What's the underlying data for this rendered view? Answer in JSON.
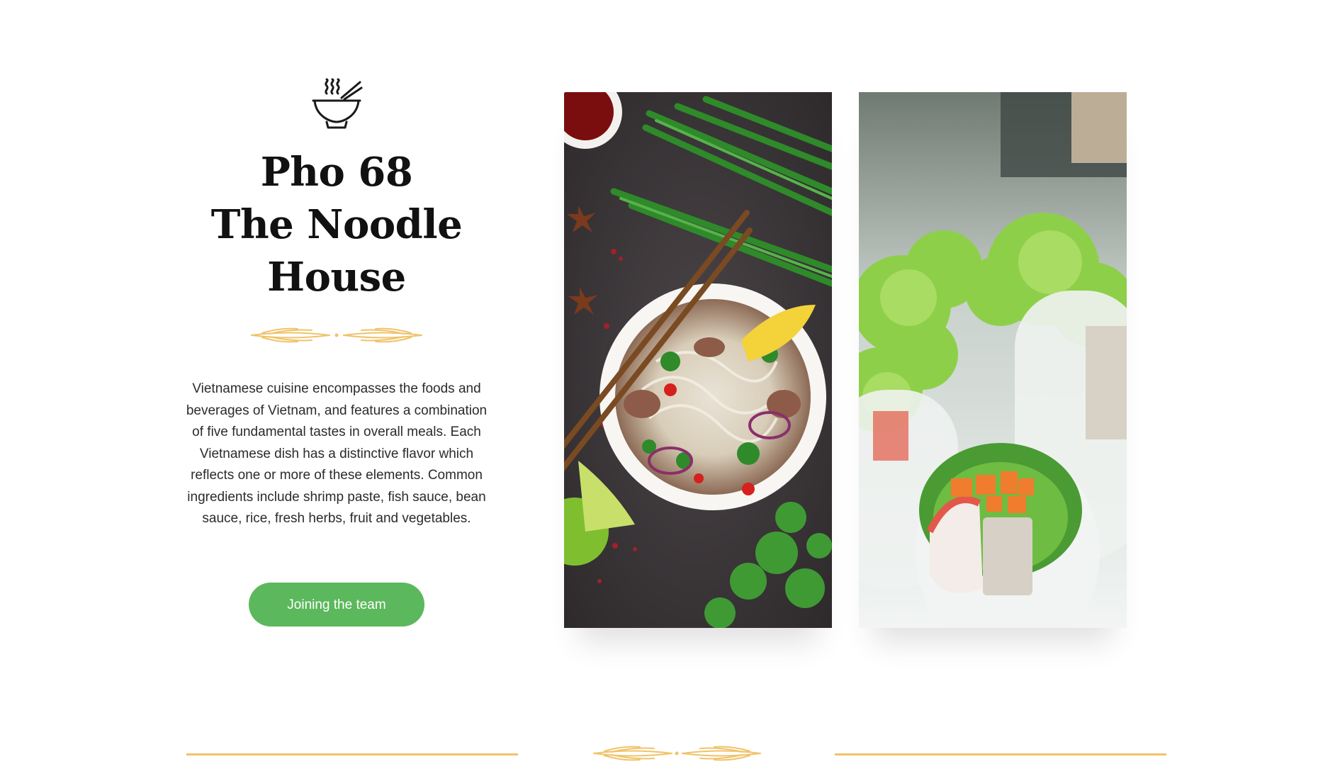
{
  "intro": {
    "icon": "noodle-bowl-icon",
    "title_line1": "Pho 68",
    "title_line2": "The Noodle",
    "title_line3": "House",
    "description": "Vietnamese cuisine encompasses the foods and beverages of Vietnam, and features a combination of five fundamental tastes in overall meals. Each Vietnamese dish has a distinctive flavor which reflects one or more of these elements. Common ingredients include shrimp paste, fish sauce, bean sauce, rice, fresh herbs, fruit and vegetables.",
    "cta_label": "Joining the team"
  },
  "colors": {
    "accent_green": "#5cb85c",
    "ornament_gold": "#f0c36a",
    "title": "#111111",
    "text": "#2b2b2b"
  },
  "photos": [
    {
      "subject": "pho-bowl-photo"
    },
    {
      "subject": "spring-rolls-photo"
    }
  ]
}
